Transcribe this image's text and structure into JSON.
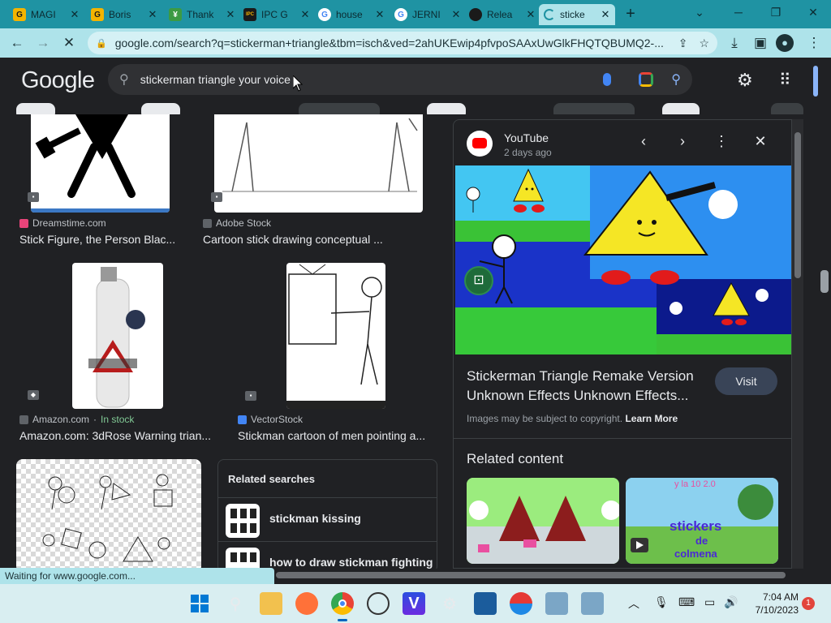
{
  "tabs": [
    {
      "label": "MAGI",
      "favicon": "G",
      "color": "#f4b400"
    },
    {
      "label": "Boris",
      "favicon": "G",
      "color": "#f4b400"
    },
    {
      "label": "Thank",
      "favicon": "¥",
      "color": "#3c9a43"
    },
    {
      "label": "IPC G",
      "favicon": "IPC",
      "color": "#1a1a1a"
    },
    {
      "label": "house",
      "favicon": "G",
      "color": "#4285f4"
    },
    {
      "label": "JERNI",
      "favicon": "G",
      "color": "#4285f4"
    },
    {
      "label": "Relea",
      "favicon": "gh",
      "color": "#1a1a1a"
    },
    {
      "label": "sticke",
      "favicon": "",
      "color": "#1f93a3"
    }
  ],
  "toolbar": {
    "url": "google.com/search?q=stickerman+triangle&tbm=isch&ved=2ahUKEwip4pfvpoSAAxUwGlkFHQTQBUMQ2-..."
  },
  "google": {
    "logo": "Google",
    "query": "stickerman triangle your voice"
  },
  "results": [
    {
      "source": "Dreamstime.com",
      "title": "Stick Figure, the Person Blac...",
      "source_color": "#e8447a"
    },
    {
      "source": "Adobe Stock",
      "title": "Cartoon stick drawing conceptual ...",
      "source_color": "#5f6368"
    },
    {
      "source": "Amazon.com",
      "stock": "In stock",
      "title": "Amazon.com: 3dRose Warning trian...",
      "source_color": "#5f6368"
    },
    {
      "source": "VectorStock",
      "title": "Stickman cartoon of men pointing a...",
      "source_color": "#4285f4"
    }
  ],
  "related_searches": {
    "heading": "Related searches",
    "items": [
      "stickman kissing",
      "how to draw stickman fighting"
    ]
  },
  "panel": {
    "source": "YouTube",
    "date": "2 days ago",
    "title": "Stickerman Triangle Remake Version Unknown Effects Unknown Effects...",
    "visit": "Visit",
    "copyright_text": "Images may be subject to copyright.",
    "learn_more": "Learn More",
    "related_title": "Related content",
    "rc2_text_top": "y la 10 2.0",
    "rc2_text_mid": "stickers",
    "rc2_text_de": "de",
    "rc2_text_bottom": "colmena"
  },
  "status": "Waiting for www.google.com...",
  "clock": {
    "time": "7:04 AM",
    "date": "7/10/2023"
  },
  "notifications": "1"
}
